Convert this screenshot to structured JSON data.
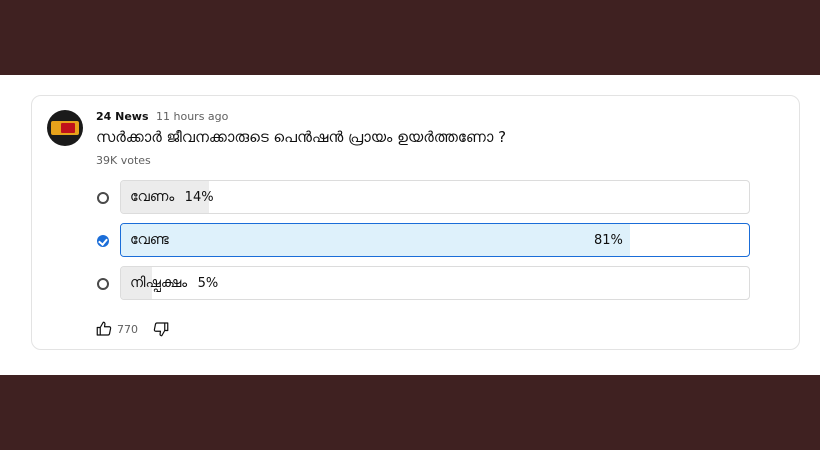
{
  "post": {
    "channel_name": "24 News",
    "time_ago": "11 hours ago",
    "question": "സർക്കാർ ജീവനക്കാരുടെ പെൻഷൻ പ്രായം ഉയർത്തണോ ?",
    "votes": "39K votes"
  },
  "options": [
    {
      "label": "വേണം",
      "percent_text": "14%",
      "percent": 14,
      "selected": false
    },
    {
      "label": "വേണ്ട",
      "percent_text": "81%",
      "percent": 81,
      "selected": true
    },
    {
      "label": "നിഷ്പക്ഷം",
      "percent_text": "5%",
      "percent": 5,
      "selected": false
    }
  ],
  "actions": {
    "like_count": "770",
    "like_icon": "thumbs-up-icon",
    "dislike_icon": "thumbs-down-icon"
  },
  "colors": {
    "background": "#3f2121",
    "accent": "#1a6dd8",
    "selected_fill": "#def1fb",
    "unselected_fill": "#ececec"
  }
}
